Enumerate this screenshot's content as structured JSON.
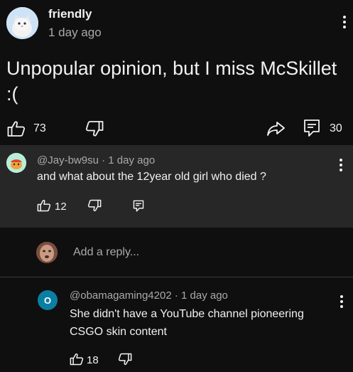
{
  "post": {
    "author": "friendly",
    "time": "1 day ago",
    "body": "Unpopular opinion, but I miss McSkillet :(",
    "likes": "73",
    "replies": "30"
  },
  "comment1": {
    "author": "@Jay-bw9su",
    "separator": "·",
    "time": "1 day ago",
    "text": "and what about the 12year old girl who died ?",
    "likes": "12"
  },
  "reply_box": {
    "placeholder": "Add a reply..."
  },
  "comment2": {
    "avatar_letter": "O",
    "author": "@obamagaming4202",
    "separator": "·",
    "time": "1 day ago",
    "text": "She didn't have a YouTube channel pioneering CSGO skin content",
    "likes": "18"
  },
  "colors": {
    "background": "#0f0f0f",
    "highlight": "#272727",
    "text": "#f1f1f1",
    "muted": "#aaaaaa",
    "avatar_o": "#0b7fa3"
  }
}
